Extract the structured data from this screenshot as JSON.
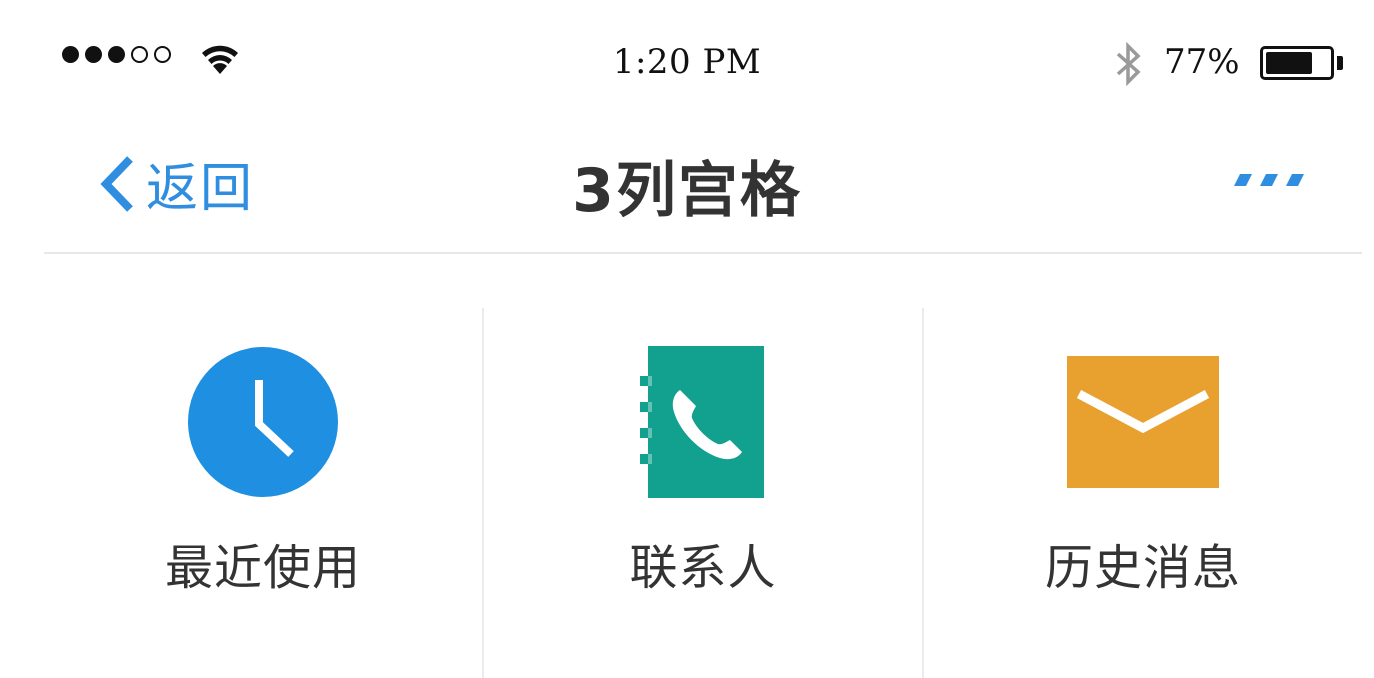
{
  "status_bar": {
    "time": "1:20 PM",
    "battery_percent": "77%",
    "battery_level": 0.77,
    "signal_bars_filled": 3,
    "signal_bars_total": 5
  },
  "nav": {
    "back_label": "返回",
    "title": "3列宫格"
  },
  "grid": {
    "items": [
      {
        "label": "最近使用",
        "icon": "clock-icon",
        "color": "#1e8fe1"
      },
      {
        "label": "联系人",
        "icon": "contacts-book-icon",
        "color": "#12a08f"
      },
      {
        "label": "历史消息",
        "icon": "envelope-icon",
        "color": "#e8a12e"
      }
    ]
  },
  "colors": {
    "accent": "#2f8ee0",
    "title_text": "#333333",
    "divider": "#e8e8e8"
  }
}
